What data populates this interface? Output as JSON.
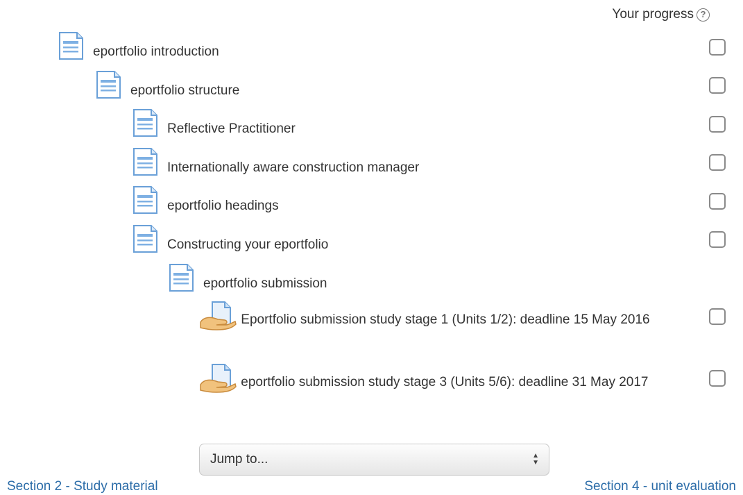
{
  "progress": {
    "label": "Your progress"
  },
  "items": [
    {
      "label": "eportfolio introduction",
      "icon": "page-icon",
      "checked": false
    },
    {
      "label": "eportfolio structure",
      "icon": "page-icon",
      "checked": false
    },
    {
      "label": "Reflective Practitioner",
      "icon": "page-icon",
      "checked": false
    },
    {
      "label": "Internationally aware construction manager",
      "icon": "page-icon",
      "checked": false
    },
    {
      "label": "eportfolio headings",
      "icon": "page-icon",
      "checked": false
    },
    {
      "label": "Constructing your eportfolio",
      "icon": "page-icon",
      "checked": false
    },
    {
      "label": "eportfolio submission",
      "icon": "page-icon"
    },
    {
      "label": "Eportfolio submission study stage 1 (Units 1/2): deadline 15 May 2016",
      "icon": "assignment-icon",
      "checked": false
    },
    {
      "label": "eportfolio submission study stage 3 (Units 5/6): deadline 31 May 2017",
      "icon": "assignment-icon",
      "checked": false
    }
  ],
  "jump": {
    "selected": "Jump to..."
  },
  "nav": {
    "prev": "Section 2 - Study material",
    "next": "Section 4 - unit evaluation"
  },
  "colors": {
    "link": "#2b6ca8",
    "icon_blue": "#6aa0d8"
  }
}
